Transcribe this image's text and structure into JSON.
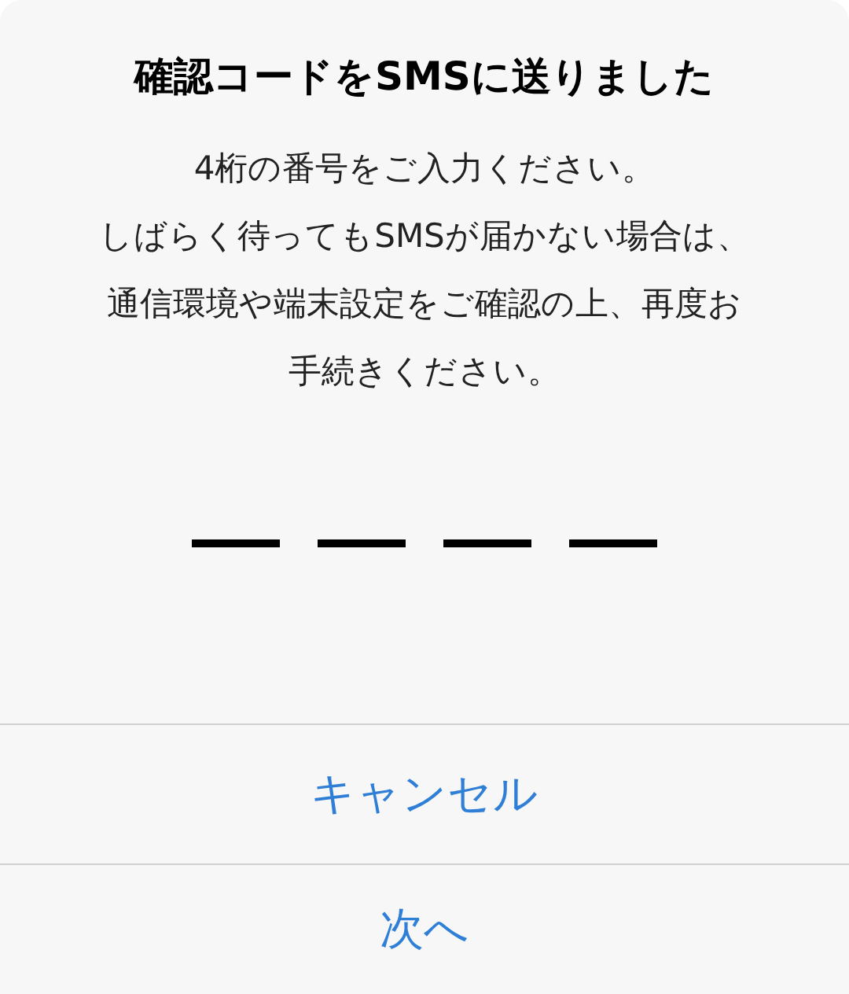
{
  "dialog": {
    "title": "確認コードをSMSに送りました",
    "message": [
      "4桁の番号をご入力ください。",
      "しばらく待ってもSMSが届かない場合は、",
      "通信環境や端末設定をご確認の上、再度お手続きください。"
    ],
    "code_slots": [
      {
        "kind": "digit"
      },
      {
        "kind": "digit"
      },
      {
        "kind": "digit"
      },
      {
        "kind": "digit"
      }
    ],
    "buttons": [
      {
        "label": "キャンセル"
      },
      {
        "label": "次へ"
      }
    ]
  }
}
